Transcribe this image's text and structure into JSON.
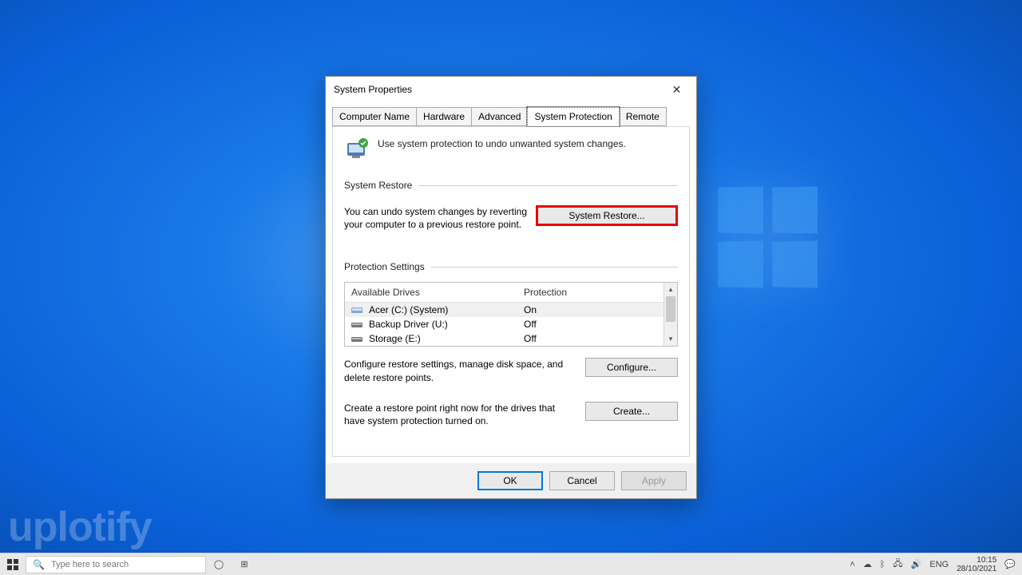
{
  "dialog": {
    "title": "System Properties",
    "intro_text": "Use system protection to undo unwanted system changes."
  },
  "tabs": [
    "Computer Name",
    "Hardware",
    "Advanced",
    "System Protection",
    "Remote"
  ],
  "active_tab_index": 3,
  "system_restore": {
    "heading": "System Restore",
    "desc": "You can undo system changes by reverting your computer to a previous restore point.",
    "button": "System Restore..."
  },
  "protection_settings": {
    "heading": "Protection Settings",
    "columns": {
      "drives": "Available Drives",
      "protection": "Protection"
    },
    "rows": [
      {
        "name": "Acer (C:) (System)",
        "protection": "On",
        "selected": true,
        "system": true
      },
      {
        "name": "Backup Driver (U:)",
        "protection": "Off",
        "selected": false,
        "system": false
      },
      {
        "name": "Storage (E:)",
        "protection": "Off",
        "selected": false,
        "system": false
      }
    ],
    "configure_desc": "Configure restore settings, manage disk space, and delete restore points.",
    "configure_btn": "Configure...",
    "create_desc": "Create a restore point right now for the drives that have system protection turned on.",
    "create_btn": "Create..."
  },
  "dialog_buttons": {
    "ok": "OK",
    "cancel": "Cancel",
    "apply": "Apply"
  },
  "taskbar": {
    "search_placeholder": "Type here to search",
    "tray": {
      "lang": "ENG",
      "time": "10:15",
      "date": "28/10/2021"
    }
  },
  "watermark": "uplotify"
}
